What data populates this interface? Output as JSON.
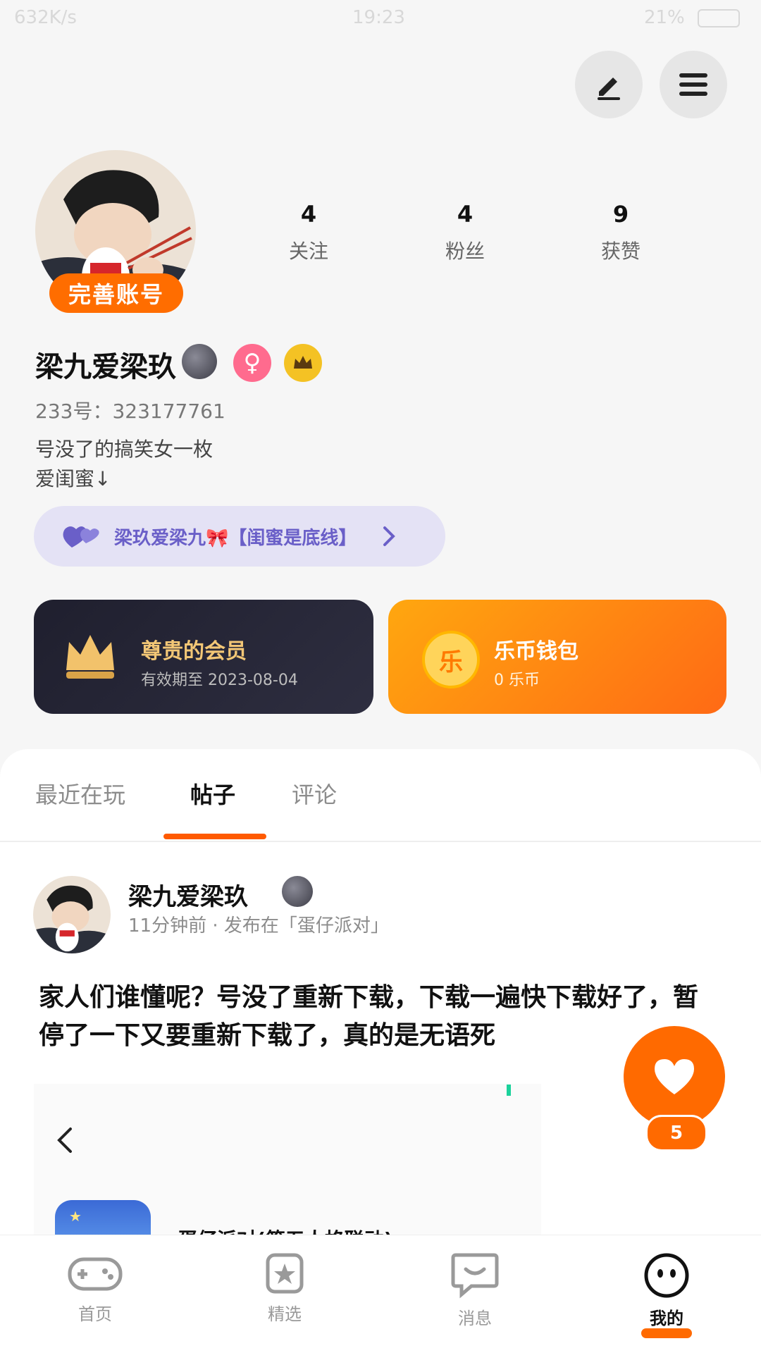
{
  "status_bar": {
    "speed": "632K/s",
    "time": "19:23",
    "battery": "21%"
  },
  "profile": {
    "complete_label": "完善账号",
    "stats": [
      {
        "value": "4",
        "label": "关注"
      },
      {
        "value": "4",
        "label": "粉丝"
      },
      {
        "value": "9",
        "label": "获赞"
      }
    ],
    "username": "梁九爱梁玖",
    "id_label": "233号：323177761",
    "bio_lines": [
      "号没了的搞笑女一枚",
      "爱闺蜜↓"
    ],
    "bestie_link": "梁玖爱梁九🎀【闺蜜是底线】"
  },
  "cards": {
    "vip": {
      "title": "尊贵的会员",
      "subtitle": "有效期至 2023-08-04"
    },
    "wallet": {
      "title": "乐币钱包",
      "subtitle": "0 乐币",
      "coin_char": "乐"
    }
  },
  "tabs": [
    {
      "label": "最近在玩"
    },
    {
      "label": "帖子"
    },
    {
      "label": "评论"
    }
  ],
  "post": {
    "author": "梁九爱梁玖",
    "meta": "11分钟前 · 发布在「蛋仔派对」",
    "text": "家人们谁懂呢？号没了重新下载，下载一遍快下载好了，暂停了一下又要重新下载了，真的是无语死",
    "game_title": "蛋仔派对(第五人格联动)",
    "like_count": "5"
  },
  "nav": [
    {
      "label": "首页",
      "icon": "gamepad-icon"
    },
    {
      "label": "精选",
      "icon": "star-icon"
    },
    {
      "label": "消息",
      "icon": "message-icon"
    },
    {
      "label": "我的",
      "icon": "smile-icon"
    }
  ],
  "colors": {
    "accent": "#ff6a00",
    "vip_gold": "#f3c776"
  }
}
